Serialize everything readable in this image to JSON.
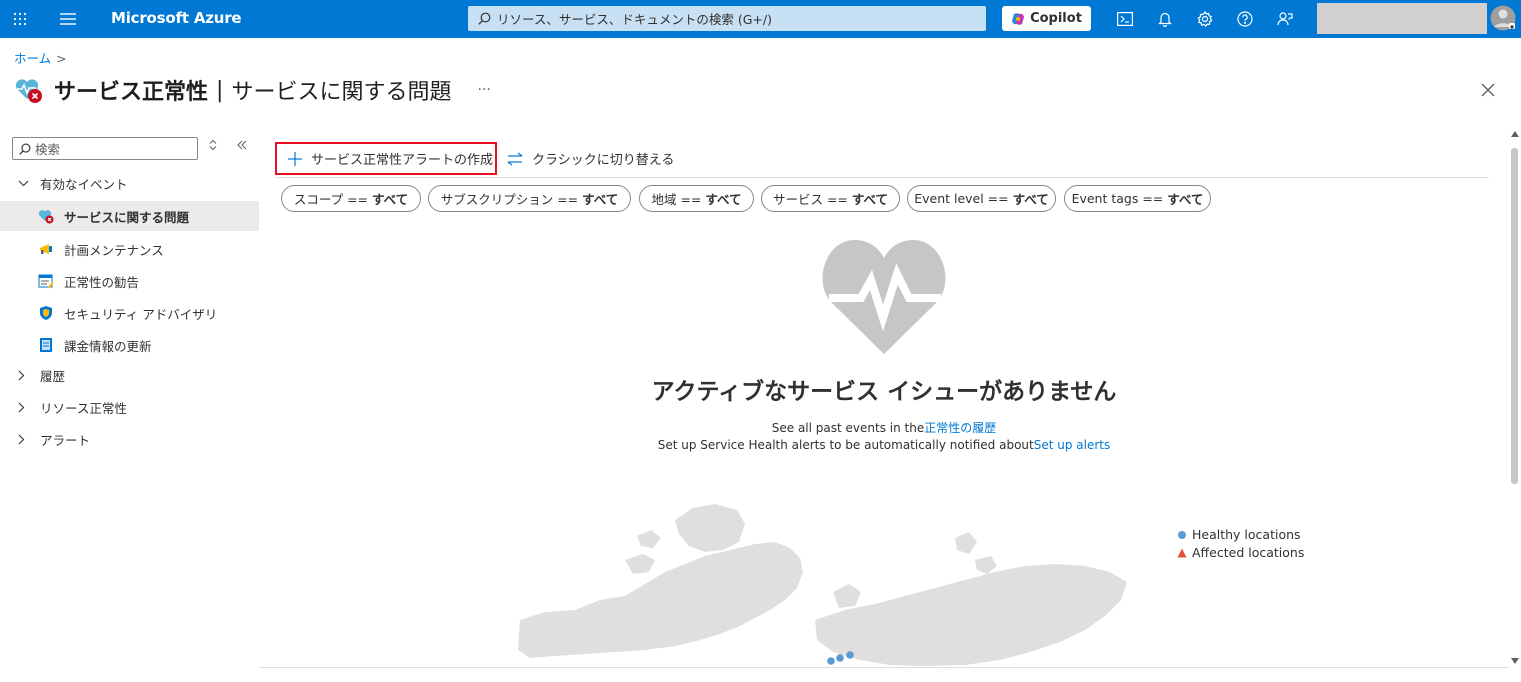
{
  "topbar": {
    "brand": "Microsoft Azure",
    "search_placeholder": "リソース、サービス、ドキュメントの検索 (G+/)",
    "copilot_label": "Copilot",
    "icons": [
      "grid-icon",
      "hamburger-icon",
      "cloud-shell-icon",
      "bell-icon",
      "gear-icon",
      "help-icon",
      "feedback-icon",
      "avatar-icon"
    ]
  },
  "breadcrumb": {
    "home": "ホーム",
    "sep": ">"
  },
  "header": {
    "title": "サービス正常性",
    "separator": "|",
    "subtitle": "サービスに関する問題",
    "more": "···"
  },
  "sidebar": {
    "search_placeholder": "検索",
    "groups": [
      {
        "label": "有効なイベント",
        "expanded": true
      },
      {
        "label": "履歴",
        "expanded": false
      },
      {
        "label": "リソース正常性",
        "expanded": false
      },
      {
        "label": "アラート",
        "expanded": false
      }
    ],
    "items": [
      {
        "label": "サービスに関する問題",
        "icon": "service-issue-icon",
        "active": true
      },
      {
        "label": "計画メンテナンス",
        "icon": "megaphone-icon",
        "active": false
      },
      {
        "label": "正常性の勧告",
        "icon": "advisory-icon",
        "active": false
      },
      {
        "label": "セキュリティ アドバイザリ",
        "icon": "shield-icon",
        "active": false
      },
      {
        "label": "課金情報の更新",
        "icon": "billing-icon",
        "active": false
      }
    ]
  },
  "toolbar": {
    "create_alert": "サービス正常性アラートの作成",
    "switch_classic": "クラシックに切り替える"
  },
  "filters": [
    {
      "key": "スコープ ==",
      "value": "すべて"
    },
    {
      "key": "サブスクリプション ==",
      "value": "すべて"
    },
    {
      "key": "地域 ==",
      "value": "すべて"
    },
    {
      "key": "サービス ==",
      "value": "すべて"
    },
    {
      "key": "Event level ==",
      "value": "すべて"
    },
    {
      "key": "Event tags ==",
      "value": "すべて"
    }
  ],
  "empty_state": {
    "title": "アクティブなサービス イシューがありません",
    "line1_text": "See all past events in the",
    "line1_link": "正常性の履歴",
    "line2_text": "Set up Service Health alerts to be automatically notified about",
    "line2_link": "Set up alerts"
  },
  "map_legend": {
    "healthy": "Healthy locations",
    "affected": "Affected locations",
    "healthy_color": "#5a9bd5",
    "affected_color": "#e0533a"
  },
  "colors": {
    "accent": "#0078d4",
    "highlight_border": "#e81123"
  }
}
